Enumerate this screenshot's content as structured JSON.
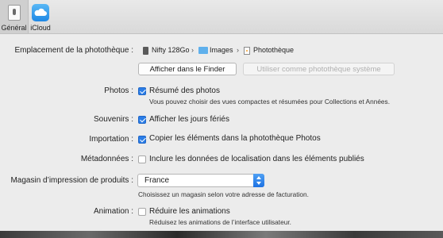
{
  "toolbar": {
    "tabs": [
      {
        "label": "Général",
        "icon": "general-switch-icon",
        "selected": true
      },
      {
        "label": "iCloud",
        "icon": "icloud-icon",
        "selected": false
      }
    ]
  },
  "library_location": {
    "label": "Emplacement de la photothèque :",
    "path": [
      {
        "name": "Nifty 128Go",
        "icon": "disk-icon"
      },
      {
        "name": "Images",
        "icon": "folder-icon"
      },
      {
        "name": "Photothèque",
        "icon": "photo-library-icon"
      }
    ],
    "show_in_finder": "Afficher dans le Finder",
    "use_as_system": "Utiliser comme photothèque système"
  },
  "photos": {
    "label": "Photos :",
    "checkbox": "Résumé des photos",
    "checked": true,
    "description": "Vous pouvez choisir des vues compactes et résumées pour Collections et Années."
  },
  "memories": {
    "label": "Souvenirs :",
    "checkbox": "Afficher les jours fériés",
    "checked": true
  },
  "import": {
    "label": "Importation :",
    "checkbox": "Copier les éléments dans la photothèque Photos",
    "checked": true
  },
  "metadata": {
    "label": "Métadonnées :",
    "checkbox": "Inclure les données de localisation dans les éléments publiés",
    "checked": false
  },
  "print_store": {
    "label": "Magasin d’impression de produits :",
    "value": "France",
    "description": "Choisissez un magasin selon votre adresse de facturation."
  },
  "animation": {
    "label": "Animation :",
    "checkbox": "Réduire les animations",
    "checked": false,
    "description": "Réduisez les animations de l’interface utilisateur."
  },
  "colors": {
    "accent": "#2b7de6",
    "background": "#ececec"
  }
}
